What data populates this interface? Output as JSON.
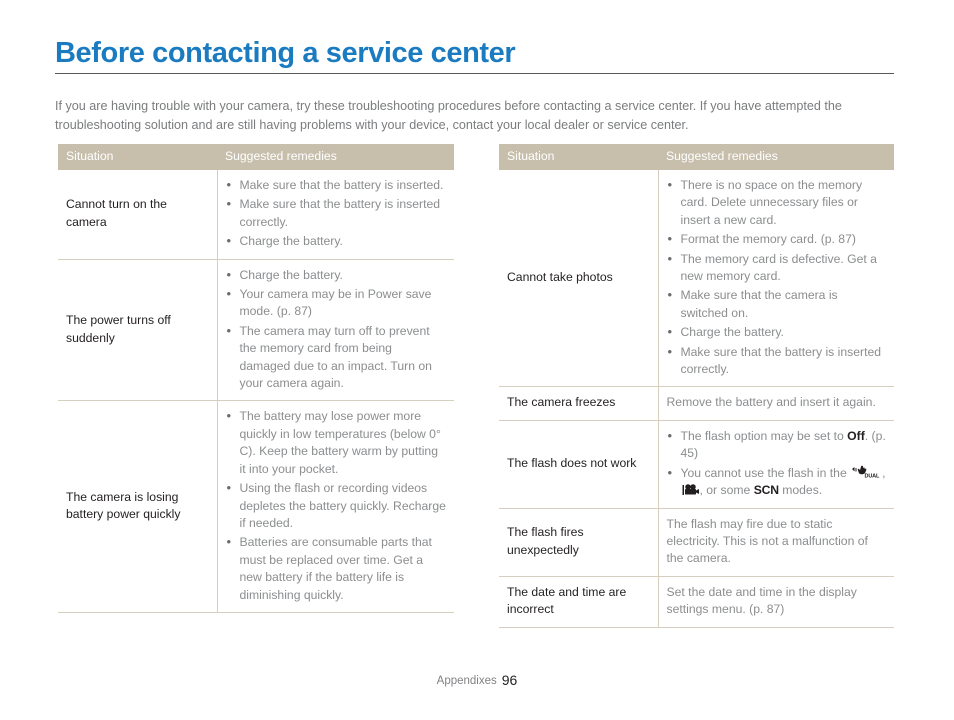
{
  "page": {
    "title": "Before contacting a service center",
    "intro": "If you are having trouble with your camera, try these troubleshooting procedures before contacting a service center. If you have attempted the troubleshooting solution and are still having problems with your device, contact your local dealer or service center.",
    "footer_label": "Appendixes",
    "footer_page": "96",
    "title_color": "#1b7bc0",
    "header_bg": "#c7bfac",
    "rule_color": "#58595b",
    "border_color": "#d6cfc0"
  },
  "tables": {
    "headers": {
      "situation": "Situation",
      "remedies": "Suggested remedies"
    },
    "left_rows": [
      {
        "situation": "Cannot turn on the camera",
        "remedies": [
          "Make sure that the battery is inserted.",
          "Make sure that the battery is inserted correctly.",
          "Charge the battery."
        ]
      },
      {
        "situation": "The power turns off suddenly",
        "remedies": [
          "Charge the battery.",
          "Your camera may be in Power save mode. (p. 87)",
          "The camera may turn off to prevent the memory card from being damaged due to an impact. Turn on your camera again."
        ]
      },
      {
        "situation": "The camera is losing battery power quickly",
        "remedies": [
          "The battery may lose power more quickly in low temperatures (below 0° C). Keep the battery warm by putting it into your pocket.",
          "Using the flash or recording videos depletes the battery quickly. Recharge if needed.",
          "Batteries are consumable parts that must be replaced over time. Get a new battery if the battery life is diminishing quickly."
        ]
      }
    ],
    "right_rows": [
      {
        "situation": "Cannot take photos",
        "remedies": [
          "There is no space on the memory card. Delete unnecessary files or insert a new card.",
          "Format the memory card. (p. 87)",
          "The memory card is defective. Get a new memory card.",
          "Make sure that the camera is switched on.",
          "Charge the battery.",
          "Make sure that the battery is inserted correctly."
        ]
      },
      {
        "situation": "The camera freezes",
        "plain": "Remove the battery and insert it again."
      },
      {
        "situation": "The flash does not work",
        "remedies_rich": {
          "item1_a": "The flash option may be set to ",
          "item1_bold": "Off",
          "item1_b": ". (p. 45)",
          "item2_a": "You cannot use the flash in the ",
          "item2_icon1": "dual-is-icon",
          "item2_b": ", ",
          "item2_icon2": "movie-camera-icon",
          "item2_c": ", or some ",
          "item2_scn": "SCN",
          "item2_d": " modes."
        }
      },
      {
        "situation": "The flash fires unexpectedly",
        "plain": "The flash may fire due to static electricity. This is not a malfunction of the camera."
      },
      {
        "situation": "The date and time are incorrect",
        "plain": "Set the date and time in the display settings menu. (p. 87)"
      }
    ]
  }
}
